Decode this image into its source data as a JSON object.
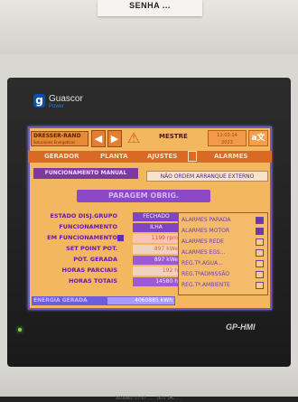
{
  "wall_label": "SENHA ...",
  "brand": {
    "mark": "g",
    "name": "Guascor",
    "sub": "Power"
  },
  "model": "GP-HMI",
  "screen": {
    "top": {
      "company": "DRESSER-RAND",
      "company_sub": "Soluciones Energeticas",
      "mode": "MESTRE",
      "clock": "11:03:14\n2023",
      "lang_icon": "a文"
    },
    "menu": [
      "GERADOR",
      "PLANTA",
      "AJUSTES",
      "ALARMES"
    ],
    "mode_button": "FUNCIONAMENTO MANUAL",
    "status_button": "NÃO ORDEM ARRANQUE EXTERNO",
    "banner": "PARAGEM OBRIG.",
    "rows": [
      {
        "label": "ESTADO DISJ.GRUPO",
        "value": "FECHADO",
        "style": "light-box"
      },
      {
        "label": "FUNCIONAMENTO",
        "value": "ILHA",
        "style": "box"
      },
      {
        "label": "EM FUNCIONAMENTO",
        "value": "1199 rpm",
        "style": "sel",
        "marker": true
      },
      {
        "label": "SET POINT POT.",
        "value": "897 kWe",
        "style": "light"
      },
      {
        "label": "POT. GERADA",
        "value": "897 kWe",
        "style": "box"
      },
      {
        "label": "HORAS PARCIAIS",
        "value": "192 h",
        "style": "light"
      },
      {
        "label": "HORAS TOTAIS",
        "value": "14580 h",
        "style": "box"
      }
    ],
    "energy": {
      "label": "ENERGIA GERADA",
      "value": "4060885 kWh"
    },
    "alarms": [
      {
        "label": "ALARMES PARADA",
        "on": true
      },
      {
        "label": "ALARMES MOTOR",
        "on": true
      },
      {
        "label": "ALARMES REDE",
        "on": false
      },
      {
        "label": "ALARMES EGS...",
        "on": false
      },
      {
        "label": "REG.Tª.AGUA...",
        "on": false
      },
      {
        "label": "REG.TªADMISSÃO",
        "on": false
      },
      {
        "label": "REG.Tª.AMBIENTE",
        "on": false
      }
    ]
  },
  "photo_footer": "20230802 11:07 ... 1623 IMG ..."
}
